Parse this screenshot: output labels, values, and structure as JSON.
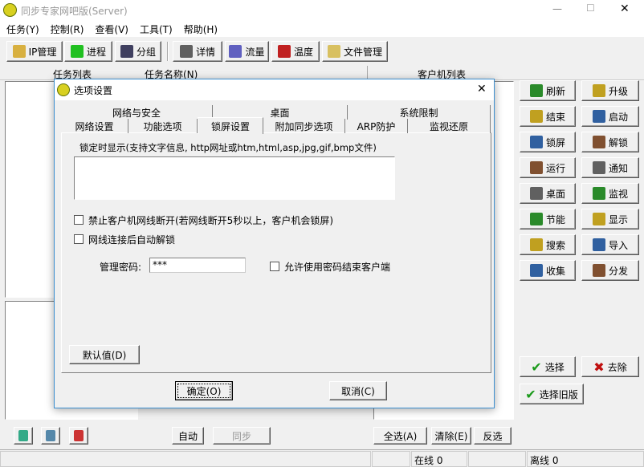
{
  "window": {
    "title": "同步专家网吧版(Server)",
    "min": "—",
    "max": "☐",
    "close": "✕"
  },
  "menu": [
    "任务(Y)",
    "控制(R)",
    "查看(V)",
    "工具(T)",
    "帮助(H)"
  ],
  "toolbar": [
    {
      "label": "IP管理",
      "icon": "ip-icon",
      "color": "#d8b040"
    },
    {
      "label": "进程",
      "icon": "process-icon",
      "color": "#20c020"
    },
    {
      "label": "分组",
      "icon": "group-icon",
      "color": "#404060"
    },
    {
      "label": "详情",
      "icon": "details-icon",
      "color": "#606060"
    },
    {
      "label": "流量",
      "icon": "traffic-icon",
      "color": "#6060c0"
    },
    {
      "label": "温度",
      "icon": "thermometer-icon",
      "color": "#c02020"
    },
    {
      "label": "文件管理",
      "icon": "file-manage-icon",
      "color": "#d8c060"
    }
  ],
  "main": {
    "task_list": "任务列表",
    "task_name": "任务名称(N)",
    "client_list": "客户机列表",
    "auto": "自动",
    "sync": "同步",
    "select_all": "全选(A)",
    "clear": "清除(E)",
    "invert": "反选"
  },
  "right_buttons": [
    [
      "刷新",
      "升级"
    ],
    [
      "结束",
      "启动"
    ],
    [
      "锁屏",
      "解锁"
    ],
    [
      "运行",
      "通知"
    ],
    [
      "桌面",
      "监视"
    ],
    [
      "节能",
      "显示"
    ],
    [
      "搜索",
      "导入"
    ],
    [
      "收集",
      "分发"
    ]
  ],
  "select": "选择",
  "remove": "去除",
  "select_old": "选择旧版",
  "status": {
    "online": "在线 0",
    "offline": "离线 0"
  },
  "dialog": {
    "title": "选项设置",
    "close": "✕",
    "tabs_row1": [
      "网络与安全",
      "桌面",
      "系统限制"
    ],
    "tabs_row2": [
      "网络设置",
      "功能选项",
      "锁屏设置",
      "附加同步选项",
      "ARP防护",
      "监视还原"
    ],
    "active_tab": "锁屏设置",
    "lock_display_label": "锁定时显示(支持文字信息, http网址或htm,html,asp,jpg,gif,bmp文件)",
    "lock_display_value": "",
    "cb1": "禁止客户机网线断开(若网线断开5秒以上，客户机会锁屏)",
    "cb2": "网线连接后自动解锁",
    "pwd_label": "管理密码:",
    "pwd_value": "***",
    "cb3": "允许使用密码结束客户端",
    "default": "默认值(D)",
    "ok": "确定(O)",
    "cancel": "取消(C)"
  }
}
